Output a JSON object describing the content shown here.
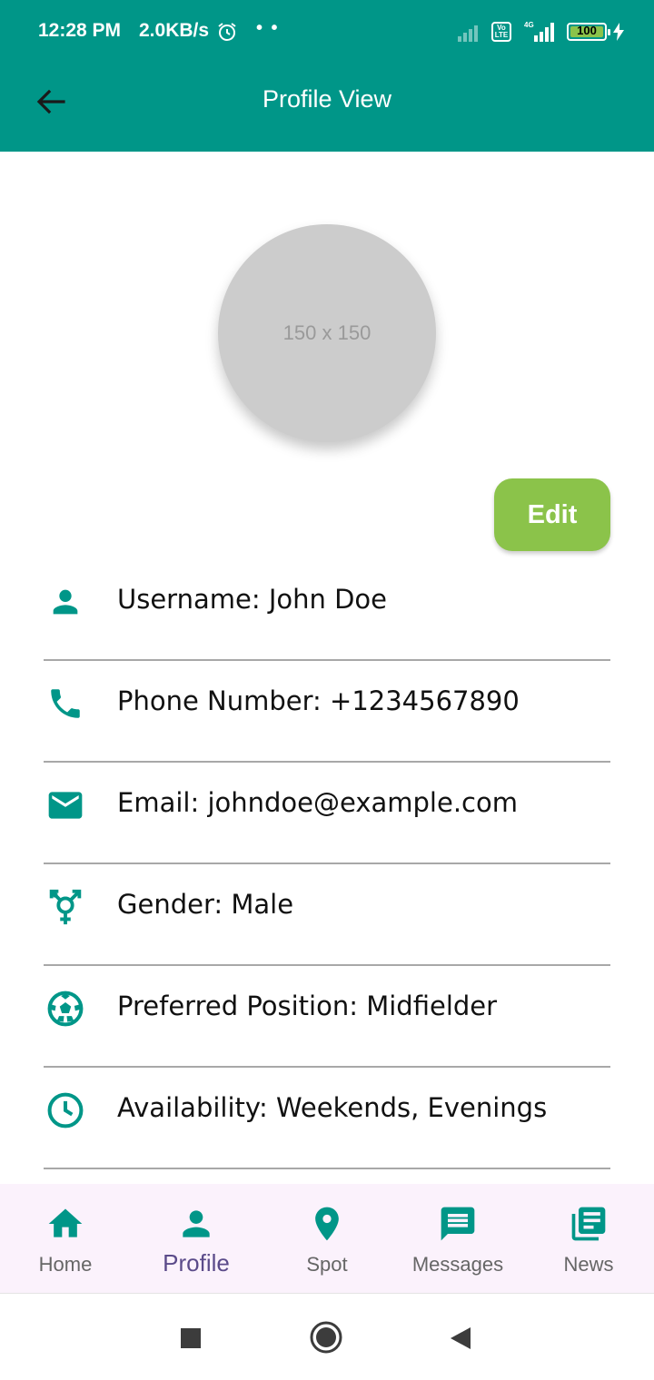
{
  "status_bar": {
    "time": "12:28 PM",
    "speed": "2.0KB/s",
    "dots": "• •",
    "volte": "Vo LTE",
    "network": "4G",
    "battery": "100"
  },
  "app_bar": {
    "title": "Profile View",
    "color": "#009688"
  },
  "profile": {
    "avatar_placeholder": "150 x 150",
    "edit_label": "Edit",
    "edit_color": "#8bc34a",
    "fields": [
      {
        "icon": "person-icon",
        "text": "Username: John Doe"
      },
      {
        "icon": "phone-icon",
        "text": "Phone Number: +1234567890"
      },
      {
        "icon": "email-icon",
        "text": "Email: johndoe@example.com"
      },
      {
        "icon": "gender-icon",
        "text": "Gender: Male"
      },
      {
        "icon": "soccer-ball-icon",
        "text": "Preferred Position: Midfielder"
      },
      {
        "icon": "clock-icon",
        "text": "Availability: Weekends, Evenings"
      }
    ]
  },
  "bottom_nav": {
    "items": [
      {
        "icon": "home-icon",
        "label": "Home"
      },
      {
        "icon": "person-icon",
        "label": "Profile",
        "active": true
      },
      {
        "icon": "location-pin-icon",
        "label": "Spot"
      },
      {
        "icon": "message-icon",
        "label": "Messages"
      },
      {
        "icon": "news-icon",
        "label": "News"
      }
    ],
    "active_color": "#5b4b8a",
    "icon_color": "#009688"
  }
}
